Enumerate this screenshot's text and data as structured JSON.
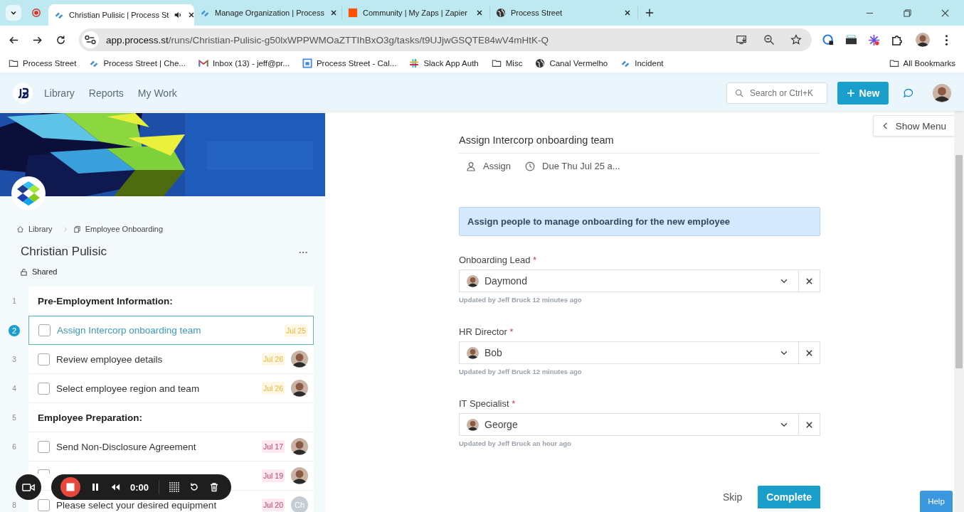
{
  "browser": {
    "tabs": [
      {
        "title": "Christian Pulisic | Process St",
        "kind": "process",
        "selected": true,
        "audio": true
      },
      {
        "title": "Manage Organization | Process",
        "kind": "process",
        "selected": false,
        "audio": false
      },
      {
        "title": "Community | My Zaps | Zapier",
        "kind": "square",
        "selected": false,
        "audio": false
      },
      {
        "title": "Process Street",
        "kind": "globe",
        "selected": false,
        "audio": false
      }
    ],
    "url_host": "app.process.st",
    "url_path": "/runs/Christian-Pulisic-g50lxWPPWMOaZTTIhBxO3g/tasks/t9UJjwGSQTE84wV4mHtK-Q",
    "bookmarks": [
      {
        "label": "Process Street",
        "kind": "folder"
      },
      {
        "label": "Process Street | Che...",
        "kind": "process"
      },
      {
        "label": "Inbox (13) - jeff@pr...",
        "kind": "gmail"
      },
      {
        "label": "Process Street - Cal...",
        "kind": "calendar"
      },
      {
        "label": "Slack App Auth",
        "kind": "slack"
      },
      {
        "label": "Misc",
        "kind": "folder"
      },
      {
        "label": "Canal Vermelho",
        "kind": "globe"
      },
      {
        "label": "Incident",
        "kind": "process"
      }
    ],
    "all_bookmarks": "All Bookmarks"
  },
  "app_nav": {
    "links": [
      "Library",
      "Reports",
      "My Work"
    ],
    "search": {
      "placeholder": "Search or Ctrl+K"
    },
    "new_button": "New"
  },
  "run": {
    "breadcrumb": [
      "Library",
      "Employee Onboarding"
    ],
    "title": "Christian Pulisic",
    "more": "···",
    "sharing": "Shared",
    "tasks": [
      {
        "number": "1",
        "kind": "heading",
        "label": "Pre-Employment Information:"
      },
      {
        "number": "2",
        "kind": "task",
        "label": "Assign Intercorp onboarding team",
        "due": "Jul 25",
        "overdue": false,
        "has_photo": false,
        "selected": true
      },
      {
        "number": "3",
        "kind": "task",
        "label": "Review employee details",
        "due": "Jul 26",
        "overdue": false,
        "has_photo": true,
        "selected": false
      },
      {
        "number": "4",
        "kind": "task",
        "label": "Select employee region and team",
        "due": "Jul 26",
        "overdue": false,
        "has_photo": true,
        "selected": false
      },
      {
        "number": "5",
        "kind": "heading",
        "label": "Employee Preparation:"
      },
      {
        "number": "6",
        "kind": "task",
        "label": "Send Non-Disclosure Agreement",
        "due": "Jul 17",
        "overdue": true,
        "has_photo": true,
        "selected": false
      },
      {
        "kind": "task",
        "due": "Jul 19",
        "overdue": true,
        "has_photo": true,
        "selected": false
      },
      {
        "number": "8",
        "kind": "task",
        "label": "Please select your desired equipment",
        "due": "Jul 20",
        "overdue": true,
        "initials": "Ch",
        "selected": false
      }
    ]
  },
  "task": {
    "title": "Assign Intercorp onboarding team",
    "assign": "Assign",
    "due": "Due Thu Jul 25 a...",
    "notice": "Assign people to manage onboarding for the new employee",
    "fields": [
      {
        "label": "Onboarding Lead",
        "required": "*",
        "value": "Daymond",
        "updated": "Updated by Jeff Bruck 12 minutes ago"
      },
      {
        "label": "HR Director",
        "required": "*",
        "value": "Bob",
        "updated": "Updated by Jeff Bruck 12 minutes ago"
      },
      {
        "label": "IT Specialist",
        "required": "*",
        "value": "George",
        "updated": "Updated by Jeff Bruck an hour ago"
      }
    ],
    "skip": "Skip",
    "complete": "Complete"
  },
  "show_menu": "Show Menu",
  "help": "Help",
  "recorder": {
    "time": "0:00"
  }
}
